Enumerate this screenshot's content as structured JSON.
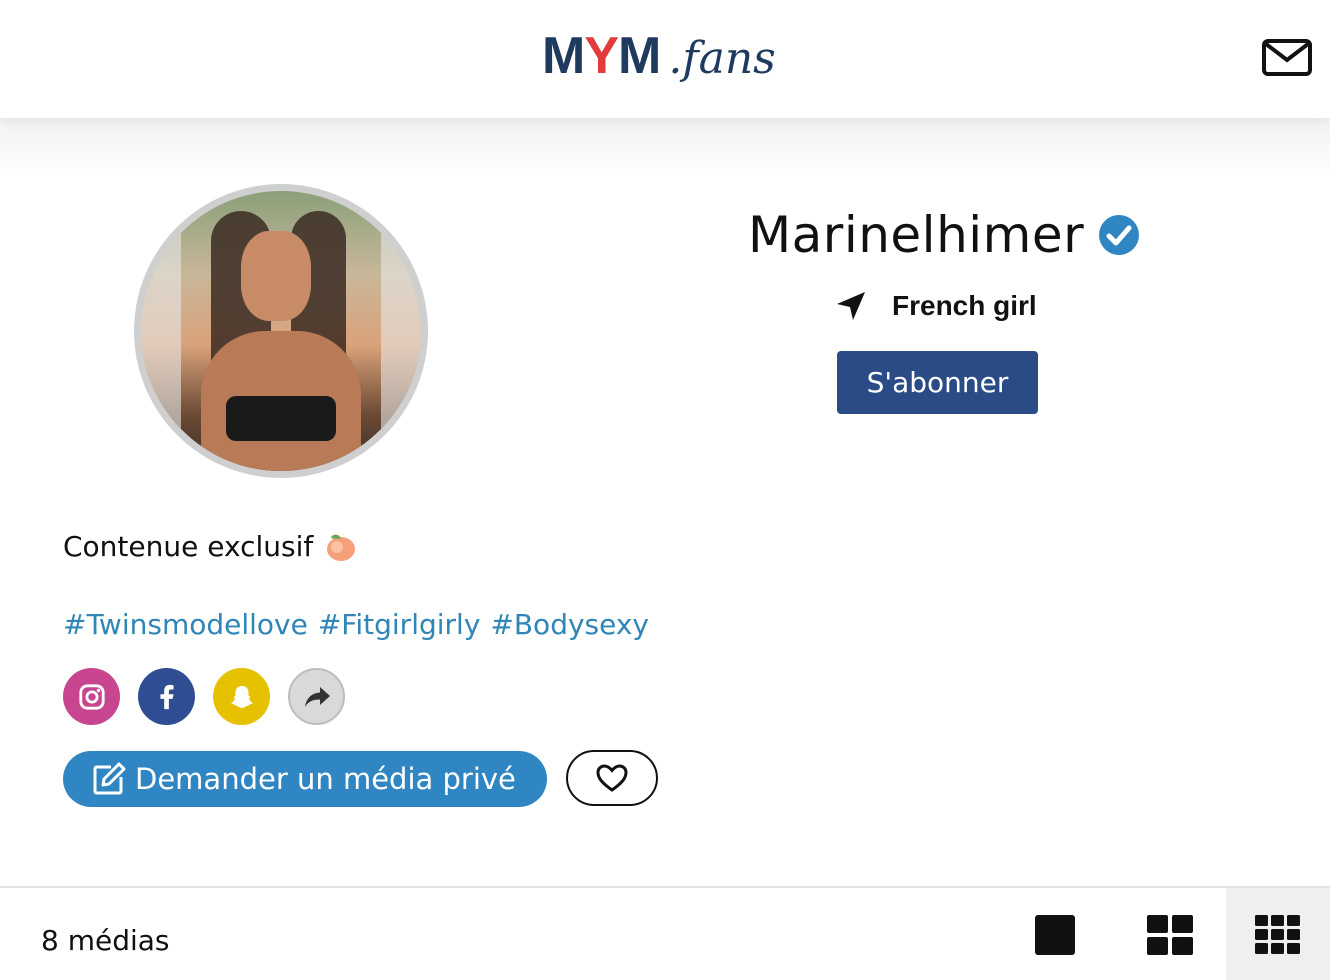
{
  "header": {
    "logo_main_a": "MY",
    "logo_main_b": "M",
    "logo_suffix": ".fans",
    "mail_icon": "envelope-icon"
  },
  "profile": {
    "username": "Marinelhimer",
    "verified_icon": "verified-badge-icon",
    "location_icon": "location-arrow-icon",
    "location": "French girl",
    "subscribe_label": "S'abonner",
    "bio": "Contenue exclusif",
    "bio_emoji_icon": "peach-emoji-icon",
    "hashtags": [
      "#Twinsmodellove",
      "#Fitgirlgirly",
      "#Bodysexy"
    ],
    "socials": [
      "instagram-icon",
      "facebook-icon",
      "snapchat-icon",
      "share-icon"
    ],
    "request_label": "Demander un média privé",
    "request_icon": "edit-icon",
    "favorite_icon": "heart-icon"
  },
  "gallery": {
    "media_count": "8 médias",
    "views": [
      "single-view-icon",
      "grid-2x2-icon",
      "grid-3x3-icon"
    ],
    "active_view": "grid-3x3-icon"
  },
  "colors": {
    "brand_dark": "#1f3a5f",
    "brand_red": "#e23b3b",
    "subscribe_bg": "#2a4b85",
    "request_bg": "#2f86c2",
    "hashtag": "#2f86b7",
    "verified": "#2f86c2",
    "instagram": "#c8458f",
    "facebook": "#2f4d92",
    "snapchat": "#e5c100"
  }
}
